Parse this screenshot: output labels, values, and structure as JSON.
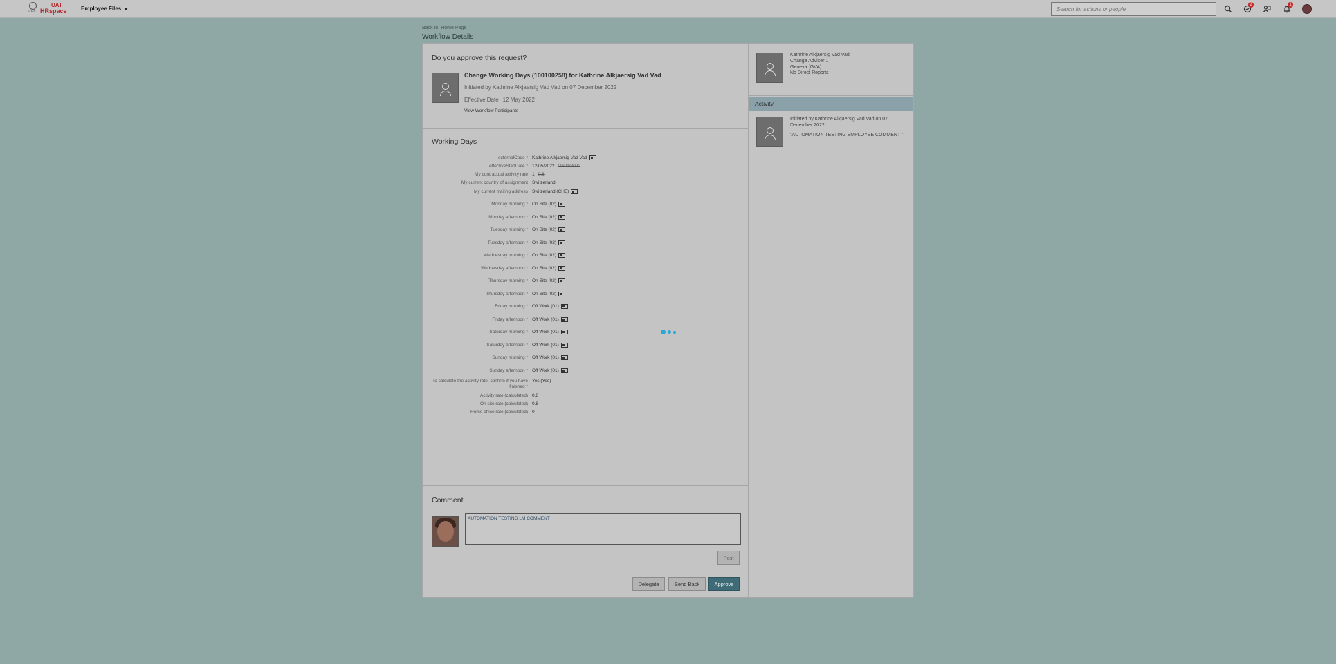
{
  "shell": {
    "logo_small": "ICRC",
    "logo_uat": "UAT",
    "logo_hr": "HRspace",
    "menu_label": "Employee Files",
    "search_placeholder": "Search for actions or people",
    "badges": {
      "todo": "2",
      "notifications": "1"
    },
    "icons": [
      "search-icon",
      "todo-icon",
      "people-icon",
      "notification-icon",
      "user-avatar"
    ]
  },
  "breadcrumb": {
    "back_label": "Back to: Home Page",
    "title": "Workflow Details"
  },
  "request": {
    "question": "Do you approve this request?",
    "title": "Change Working Days (100100258) for Kathrine Alkjaersig Vad Vad",
    "initiated": "Initiated by Kathrine Alkjaersig Vad Vad on 07 December 2022",
    "effective_label": "Effective Date",
    "effective_value": "12 May 2022",
    "participants_link": "View Workflow Participants"
  },
  "working_days": {
    "heading": "Working Days",
    "fields": [
      {
        "label": "externalCode",
        "required": "*",
        "value": "Kathrine Alkjaersig Vad Vad",
        "old": "",
        "picker": true
      },
      {
        "label": "effectiveStartDate",
        "required": "*",
        "value": "12/05/2022",
        "old": "09/01/2022",
        "picker": false
      },
      {
        "label": "My contractual activity rate",
        "required": "",
        "value": "1",
        "old": "0.8",
        "picker": false
      },
      {
        "label": "My current country of assignment",
        "required": "",
        "value": "Switzerland",
        "old": "",
        "picker": false
      },
      {
        "label": "My current mailing address",
        "required": "",
        "value": "Switzerland (CHE)",
        "old": "",
        "picker": true
      },
      {
        "label": "Monday morning",
        "required": "*",
        "value": "On Site (02)",
        "old": "",
        "picker": true
      },
      {
        "label": "Monday afternoon",
        "required": "*",
        "value": "On Site (02)",
        "old": "",
        "picker": true
      },
      {
        "label": "Tuesday morning",
        "required": "*",
        "value": "On Site (02)",
        "old": "",
        "picker": true
      },
      {
        "label": "Tuesday afternoon",
        "required": "*",
        "value": "On Site (02)",
        "old": "",
        "picker": true
      },
      {
        "label": "Wednesday morning",
        "required": "*",
        "value": "On Site (02)",
        "old": "",
        "picker": true
      },
      {
        "label": "Wednesday afternoon",
        "required": "*",
        "value": "On Site (02)",
        "old": "",
        "picker": true
      },
      {
        "label": "Thursday morning",
        "required": "*",
        "value": "On Site (02)",
        "old": "",
        "picker": true
      },
      {
        "label": "Thursday afternoon",
        "required": "*",
        "value": "On Site (02)",
        "old": "",
        "picker": true
      },
      {
        "label": "Friday morning",
        "required": "*",
        "value": "Off Work (01)",
        "old": "",
        "picker": true
      },
      {
        "label": "Friday afternoon",
        "required": "*",
        "value": "Off Work (01)",
        "old": "",
        "picker": true
      },
      {
        "label": "Saturday morning",
        "required": "*",
        "value": "Off Work (01)",
        "old": "",
        "picker": true
      },
      {
        "label": "Saturday afternoon",
        "required": "*",
        "value": "Off Work (01)",
        "old": "",
        "picker": true
      },
      {
        "label": "Sunday morning",
        "required": "*",
        "value": "Off Work (01)",
        "old": "",
        "picker": true
      },
      {
        "label": "Sunday afternoon",
        "required": "*",
        "value": "Off Work (01)",
        "old": "",
        "picker": true
      },
      {
        "label": "To calculate the activity rate, confirm if you have finished",
        "required": "*",
        "value": "Yes (Yes)",
        "old": "",
        "picker": false
      },
      {
        "label": "Activity rate (calculated)",
        "required": "",
        "value": "0.8",
        "old": "",
        "picker": false
      },
      {
        "label": "On site rate (calculated)",
        "required": "",
        "value": "0.8",
        "old": "",
        "picker": false
      },
      {
        "label": "Home office rate (calculated)",
        "required": "",
        "value": "0",
        "old": "",
        "picker": false
      }
    ]
  },
  "comment": {
    "heading": "Comment",
    "value": "AUTOMATION TESTING LM COMMENT",
    "post_label": "Post"
  },
  "actions": {
    "delegate": "Delegate",
    "send_back": "Send Back",
    "approve": "Approve"
  },
  "side": {
    "employee": {
      "name": "Kathrine Alkjaersig Vad Vad",
      "role": "Change Adviser 1",
      "location": "Geneva (GVA)",
      "reports": "No Direct Reports"
    },
    "activity_heading": "Activity",
    "activity_text": "Initiated by Kathrine Alkjaersig Vad Vad on 07 December 2022.",
    "activity_comment": "\"AUTOMATION TESTING EMPLOYEE COMMENT \""
  },
  "colors": {
    "background": "#8fa8a5",
    "accent": "#3f6b77",
    "spinner": "#2aa8d8",
    "badge": "#c62828"
  }
}
